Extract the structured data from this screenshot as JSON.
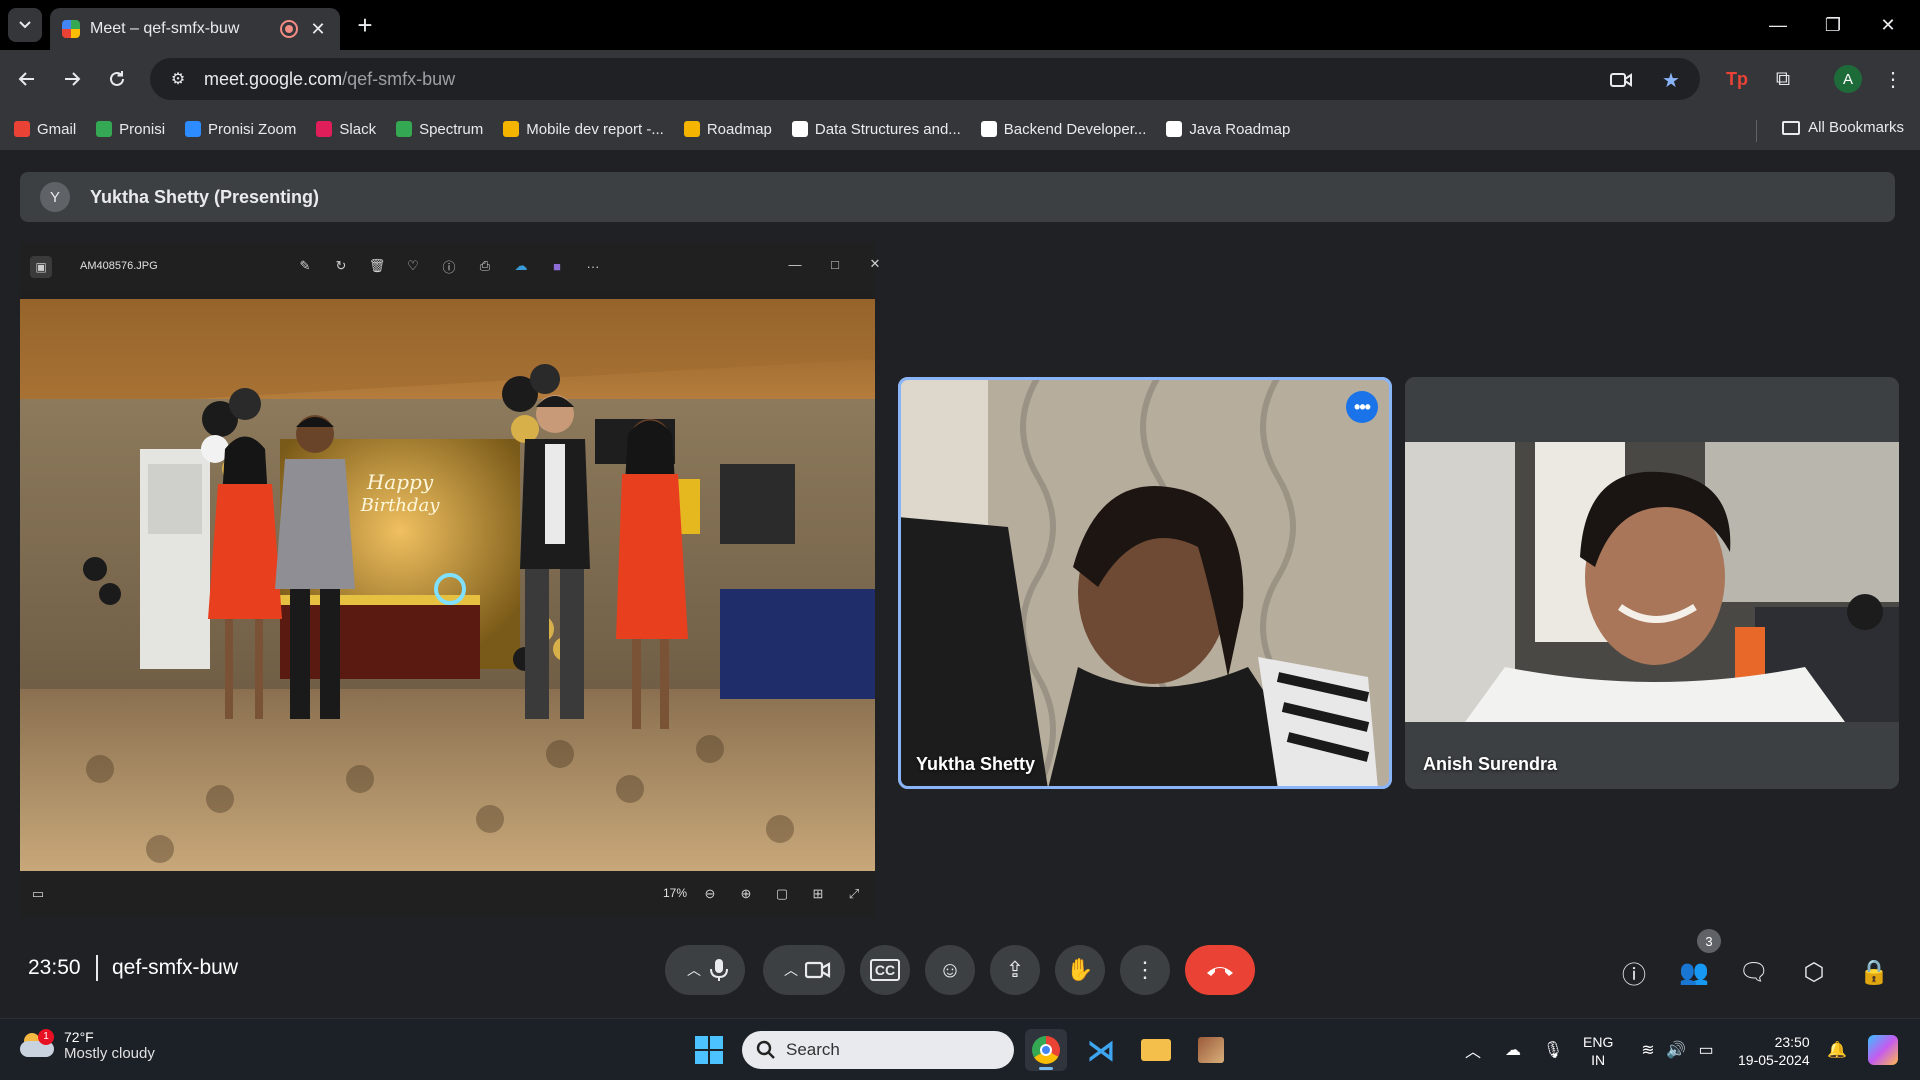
{
  "browser": {
    "tab_title": "Meet – qef-smfx-buw",
    "url_host": "meet.google.com",
    "url_path": "/qef-smfx-buw",
    "profile_initial": "A"
  },
  "bookmarks": {
    "items": [
      {
        "label": "Gmail",
        "color": "#ea4335"
      },
      {
        "label": "Pronisi",
        "color": "#34a853"
      },
      {
        "label": "Pronisi Zoom",
        "color": "#2d8cff"
      },
      {
        "label": "Slack",
        "color": "#e01e5a"
      },
      {
        "label": "Spectrum",
        "color": "#34a853"
      },
      {
        "label": "Mobile dev report -...",
        "color": "#f4b400"
      },
      {
        "label": "Roadmap",
        "color": "#f4b400"
      },
      {
        "label": "Data Structures and...",
        "color": "#ffffff"
      },
      {
        "label": "Backend Developer...",
        "color": "#ffffff"
      },
      {
        "label": "Java Roadmap",
        "color": "#ffffff"
      }
    ],
    "all_label": "All Bookmarks"
  },
  "meet": {
    "presenter_initial": "Y",
    "presenter_label": "Yuktha Shetty (Presenting)",
    "time": "23:50",
    "meeting_code": "qef-smfx-buw",
    "participant_count": "3",
    "participants": [
      {
        "name": "Yuktha Shetty"
      },
      {
        "name": "Anish Surendra"
      }
    ],
    "end_call_color": "#ea4335"
  },
  "photo_viewer": {
    "filename": "AM408576.JPG",
    "zoom": "17%"
  },
  "taskbar": {
    "weather_temp": "72°F",
    "weather_desc": "Mostly cloudy",
    "weather_badge": "1",
    "search_label": "Search",
    "lang_line1": "ENG",
    "lang_line2": "IN",
    "clock_time": "23:50",
    "clock_date": "19-05-2024"
  }
}
